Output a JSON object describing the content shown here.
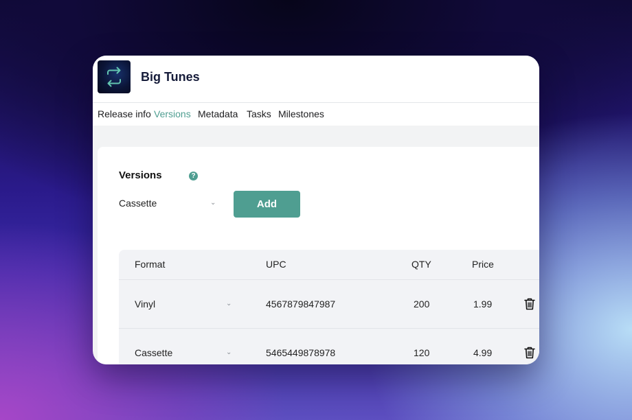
{
  "app": {
    "title": "Big Tunes",
    "logo_icon": "repeat-arrows-icon"
  },
  "tabs": [
    {
      "label": "Release info",
      "active": false
    },
    {
      "label": "Versions",
      "active": true
    },
    {
      "label": "Metadata",
      "active": false
    },
    {
      "label": "Tasks",
      "active": false
    },
    {
      "label": "Milestones",
      "active": false
    }
  ],
  "versions": {
    "title": "Versions",
    "help_icon": "question-circle-icon",
    "selected_format": "Cassette",
    "add_label": "Add"
  },
  "table": {
    "headers": [
      "Format",
      "UPC",
      "QTY",
      "Price"
    ],
    "rows": [
      {
        "format": "Vinyl",
        "upc": "4567879847987",
        "qty": "200",
        "price": "1.99"
      },
      {
        "format": "Cassette",
        "upc": "5465449878978",
        "qty": "120",
        "price": "4.99"
      }
    ]
  },
  "colors": {
    "accent": "#4f9e91",
    "title": "#161c3a"
  }
}
